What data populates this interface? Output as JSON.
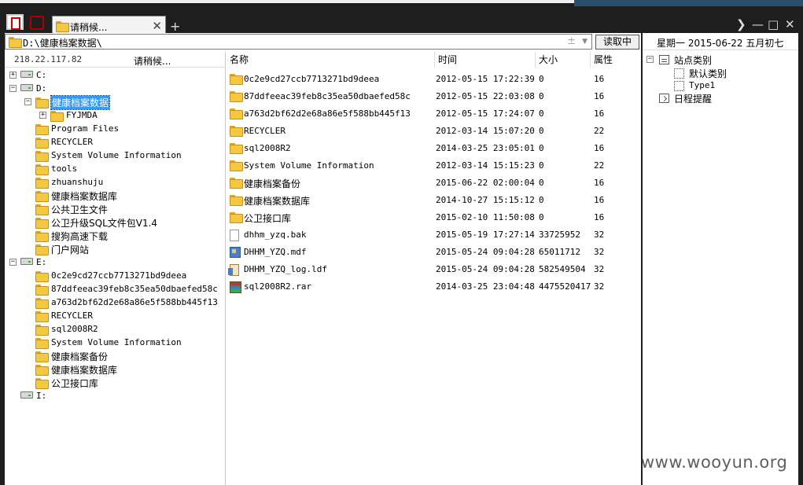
{
  "tab": {
    "label": "请稍候...",
    "close": "✕",
    "add": "+"
  },
  "window_controls": {
    "more": "❯",
    "minimize": "—",
    "maximize": "□",
    "close": "✕"
  },
  "address": {
    "path": "D:\\健康档案数据\\",
    "toggle": "±",
    "dropdown": "▼",
    "read_button": "读取中"
  },
  "left_header": {
    "ip": "218.22.117.82",
    "status": "请稍候..."
  },
  "tree": [
    {
      "label": "C:",
      "type": "drive",
      "expander": "+",
      "cn": false
    },
    {
      "label": "D:",
      "type": "drive",
      "expander": "−",
      "cn": false
    },
    {
      "label": "健康档案数据",
      "type": "folder",
      "expander": "−",
      "cn": true,
      "selected": true
    },
    {
      "label": "FYJMDA",
      "type": "folder",
      "expander": "+",
      "cn": false
    },
    {
      "label": "Program Files",
      "type": "folder",
      "cn": false
    },
    {
      "label": "RECYCLER",
      "type": "folder",
      "cn": false
    },
    {
      "label": "System Volume Information",
      "type": "folder",
      "cn": false
    },
    {
      "label": "tools",
      "type": "folder",
      "cn": false
    },
    {
      "label": "zhuanshuju",
      "type": "folder",
      "cn": false
    },
    {
      "label": "健康档案数据库",
      "type": "folder",
      "cn": true
    },
    {
      "label": "公共卫生文件",
      "type": "folder",
      "cn": true
    },
    {
      "label": "公卫升级SQL文件包V1.4",
      "type": "folder",
      "cn": true
    },
    {
      "label": "搜狗高速下载",
      "type": "folder",
      "cn": true
    },
    {
      "label": "门户网站",
      "type": "folder",
      "cn": true
    },
    {
      "label": "E:",
      "type": "drive",
      "expander": "−",
      "cn": false
    },
    {
      "label": "0c2e9cd27ccb7713271bd9deea",
      "type": "folder",
      "cn": false
    },
    {
      "label": "87ddfeeac39feb8c35ea50dbaefed58c",
      "type": "folder",
      "cn": false
    },
    {
      "label": "a763d2bf62d2e68a86e5f588bb445f13",
      "type": "folder",
      "cn": false
    },
    {
      "label": "RECYCLER",
      "type": "folder",
      "cn": false
    },
    {
      "label": "sql2008R2",
      "type": "folder",
      "cn": false
    },
    {
      "label": "System Volume Information",
      "type": "folder",
      "cn": false
    },
    {
      "label": "健康档案备份",
      "type": "folder",
      "cn": true
    },
    {
      "label": "健康档案数据库",
      "type": "folder",
      "cn": true
    },
    {
      "label": "公卫接口库",
      "type": "folder",
      "cn": true
    },
    {
      "label": "I:",
      "type": "drive",
      "cn": false
    }
  ],
  "file_list": {
    "columns": {
      "name": "名称",
      "time": "时间",
      "size": "大小",
      "attr": "属性"
    },
    "rows": [
      {
        "name": "0c2e9cd27ccb7713271bd9deea",
        "time": "2012-05-15 17:22:39",
        "size": "0",
        "attr": "16",
        "icon": "folder",
        "cn": false
      },
      {
        "name": "87ddfeeac39feb8c35ea50dbaefed58c",
        "time": "2012-05-15 22:03:08",
        "size": "0",
        "attr": "16",
        "icon": "folder",
        "cn": false
      },
      {
        "name": "a763d2bf62d2e68a86e5f588bb445f13",
        "time": "2012-05-15 17:24:07",
        "size": "0",
        "attr": "16",
        "icon": "folder",
        "cn": false
      },
      {
        "name": "RECYCLER",
        "time": "2012-03-14 15:07:20",
        "size": "0",
        "attr": "22",
        "icon": "folder",
        "cn": false
      },
      {
        "name": "sql2008R2",
        "time": "2014-03-25 23:05:01",
        "size": "0",
        "attr": "16",
        "icon": "folder",
        "cn": false
      },
      {
        "name": "System Volume Information",
        "time": "2012-03-14 15:15:23",
        "size": "0",
        "attr": "22",
        "icon": "folder",
        "cn": false
      },
      {
        "name": "健康档案备份",
        "time": "2015-06-22 02:00:04",
        "size": "0",
        "attr": "16",
        "icon": "folder",
        "cn": true
      },
      {
        "name": "健康档案数据库",
        "time": "2014-10-27 15:15:12",
        "size": "0",
        "attr": "16",
        "icon": "folder",
        "cn": true
      },
      {
        "name": "公卫接口库",
        "time": "2015-02-10 11:50:08",
        "size": "0",
        "attr": "16",
        "icon": "folder",
        "cn": true
      },
      {
        "name": "dhhm_yzq.bak",
        "time": "2015-05-19 17:27:14",
        "size": "33725952",
        "attr": "32",
        "icon": "doc",
        "cn": false
      },
      {
        "name": "DHHM_YZQ.mdf",
        "time": "2015-05-24 09:04:28",
        "size": "65011712",
        "attr": "32",
        "icon": "mdf",
        "cn": false
      },
      {
        "name": "DHHM_YZQ_log.ldf",
        "time": "2015-05-24 09:04:28",
        "size": "582549504",
        "attr": "32",
        "icon": "ldf",
        "cn": false
      },
      {
        "name": "sql2008R2.rar",
        "time": "2014-03-25 23:04:48",
        "size": "4475520417",
        "attr": "32",
        "icon": "rar",
        "cn": false
      }
    ]
  },
  "right_panel": {
    "date": "星期一 2015-06-22 五月初七",
    "items": [
      {
        "label": "站点类别",
        "expander": "−",
        "icon": "list"
      },
      {
        "label": "默认类别",
        "icon": "redbox"
      },
      {
        "label": "Type1",
        "icon": "redbox",
        "mono": true
      },
      {
        "label": "日程提醒",
        "icon": "calendar"
      }
    ]
  },
  "watermark": "www.wooyun.org"
}
